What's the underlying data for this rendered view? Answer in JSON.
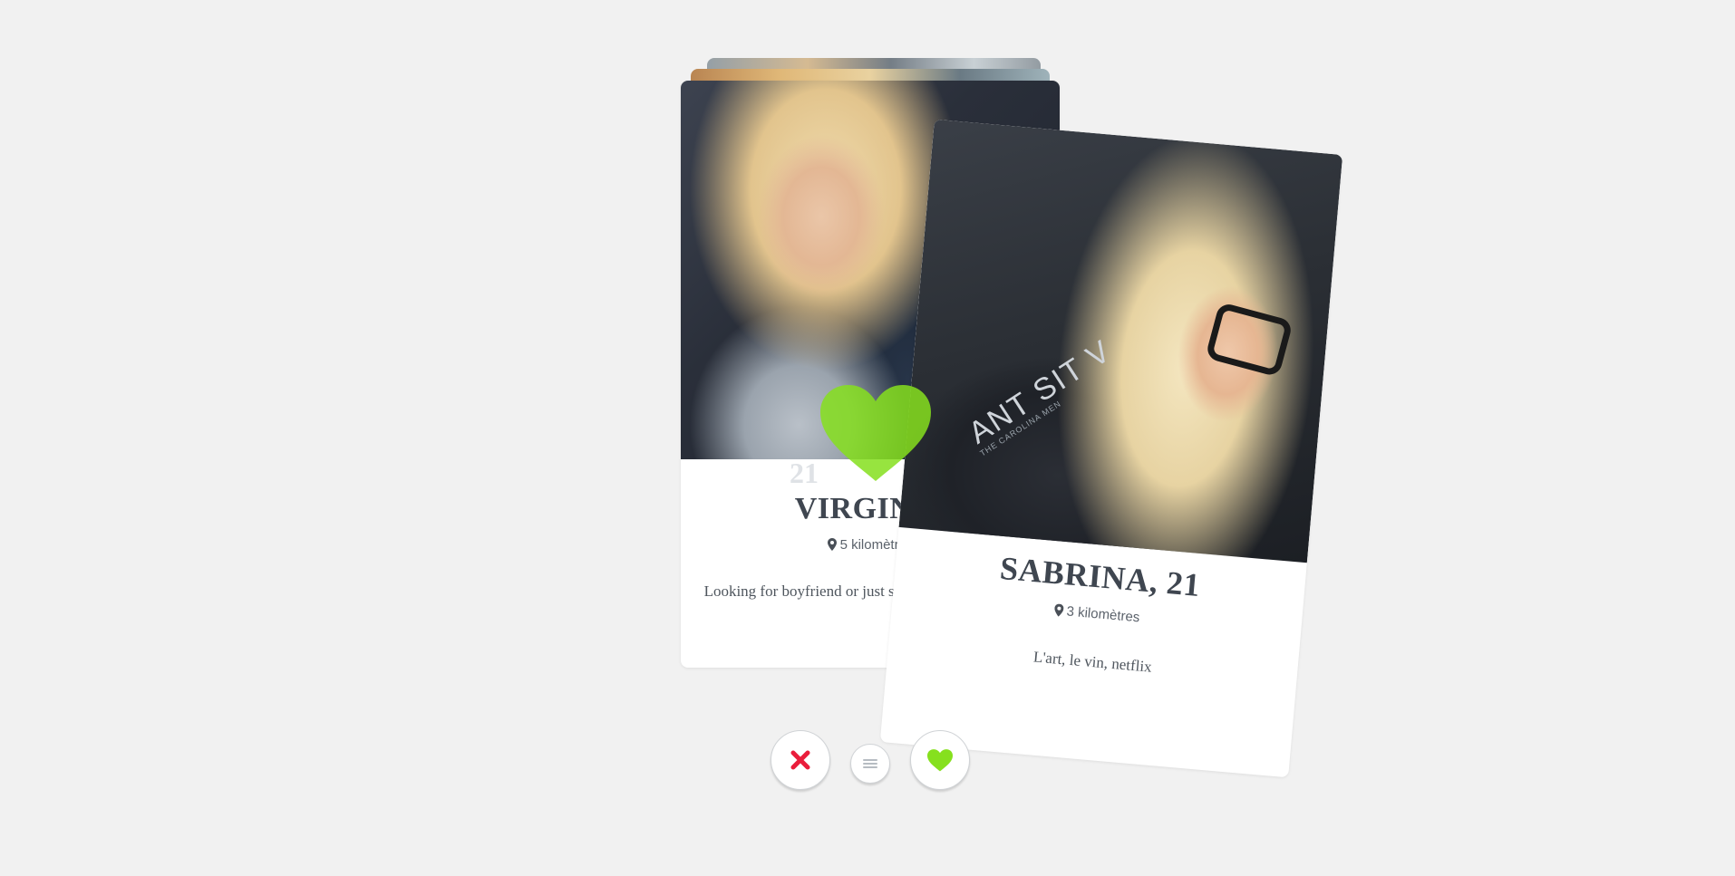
{
  "colors": {
    "background": "#f1f1f1",
    "like_green": "#86e01e",
    "dislike_red": "#ea1d3b",
    "text_dark": "#3f4650"
  },
  "cards": [
    {
      "name": "VIRGINIE",
      "age_partial": "21",
      "distance": "5 kilomètres",
      "bio": "Looking for boyfriend or just som... that way ya nas..."
    },
    {
      "name": "SABRINA, 21",
      "distance": "3 kilomètres",
      "bio": "L'art, le vin, netflix",
      "photo_shirt_text": "ANT SIT V",
      "photo_shirt_subtext": "THE CAROLINA MEN"
    }
  ],
  "overlay": {
    "icon": "heart-icon"
  },
  "actions": [
    {
      "icon": "x-icon"
    },
    {
      "icon": "menu-icon"
    },
    {
      "icon": "heart-icon"
    }
  ]
}
